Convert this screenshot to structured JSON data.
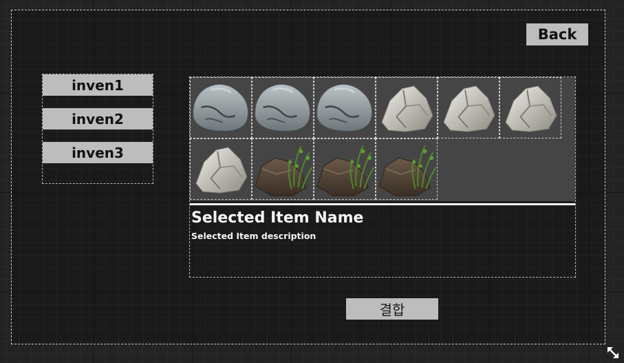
{
  "header": {
    "back_label": "Back"
  },
  "inventory_tabs": [
    {
      "label": "inven1"
    },
    {
      "label": "inven2"
    },
    {
      "label": "inven3"
    }
  ],
  "items": [
    {
      "type": "gray-boulder"
    },
    {
      "type": "gray-boulder"
    },
    {
      "type": "gray-boulder"
    },
    {
      "type": "white-rock"
    },
    {
      "type": "white-rock"
    },
    {
      "type": "white-rock"
    },
    {
      "type": "white-rock"
    },
    {
      "type": "mossy-rock"
    },
    {
      "type": "mossy-rock"
    },
    {
      "type": "mossy-rock"
    }
  ],
  "details": {
    "name": "Selected Item Name",
    "description": "Selected Item description"
  },
  "actions": {
    "combine_label": "결합"
  },
  "icons": {
    "resize": "resize-arrows-icon"
  },
  "colors": {
    "button_bg": "#bdbdbd",
    "panel_bg": "#454545",
    "canvas_bg": "#1a1a1a"
  }
}
